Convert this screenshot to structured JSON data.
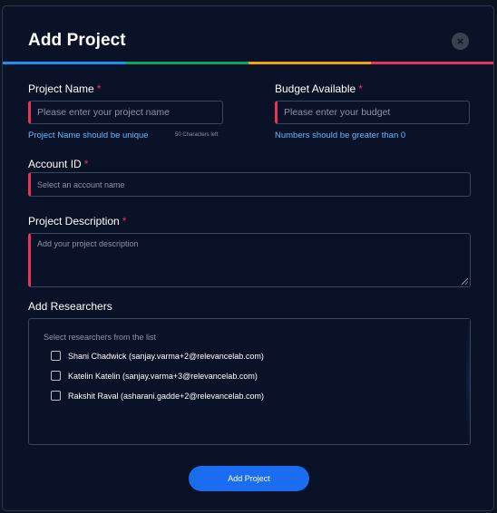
{
  "modal": {
    "title": "Add Project",
    "close_symbol": "×",
    "stripe_colors": [
      "#1f8ef1",
      "#10a35a",
      "#f0a20c",
      "#e8335b"
    ]
  },
  "project_name": {
    "label": "Project Name",
    "required_marker": "*",
    "placeholder": "Please enter your project name",
    "hint": "Project Name should be unique",
    "counter": "50 Characters left"
  },
  "budget": {
    "label": "Budget Available",
    "required_marker": "*",
    "placeholder": "Please enter your budget",
    "hint": "Numbers should be greater than 0"
  },
  "account_id": {
    "label": "Account ID",
    "required_marker": "*",
    "placeholder": "Select an account name"
  },
  "description": {
    "label": "Project Description",
    "required_marker": "*",
    "placeholder": "Add your project description"
  },
  "researchers": {
    "label": "Add Researchers",
    "hint": "Select researchers from the list",
    "items": [
      "Shani Chadwick (sanjay.varma+2@relevancelab.com)",
      "Katelin Katelin (sanjay.varma+3@relevancelab.com)",
      "Rakshit Raval (asharani.gadde+2@relevancelab.com)"
    ]
  },
  "submit_label": "Add Project",
  "colors": {
    "background": "#0a1227",
    "required": "#e8335b",
    "hint": "#69b7ff",
    "button": "#1a6cf0"
  }
}
